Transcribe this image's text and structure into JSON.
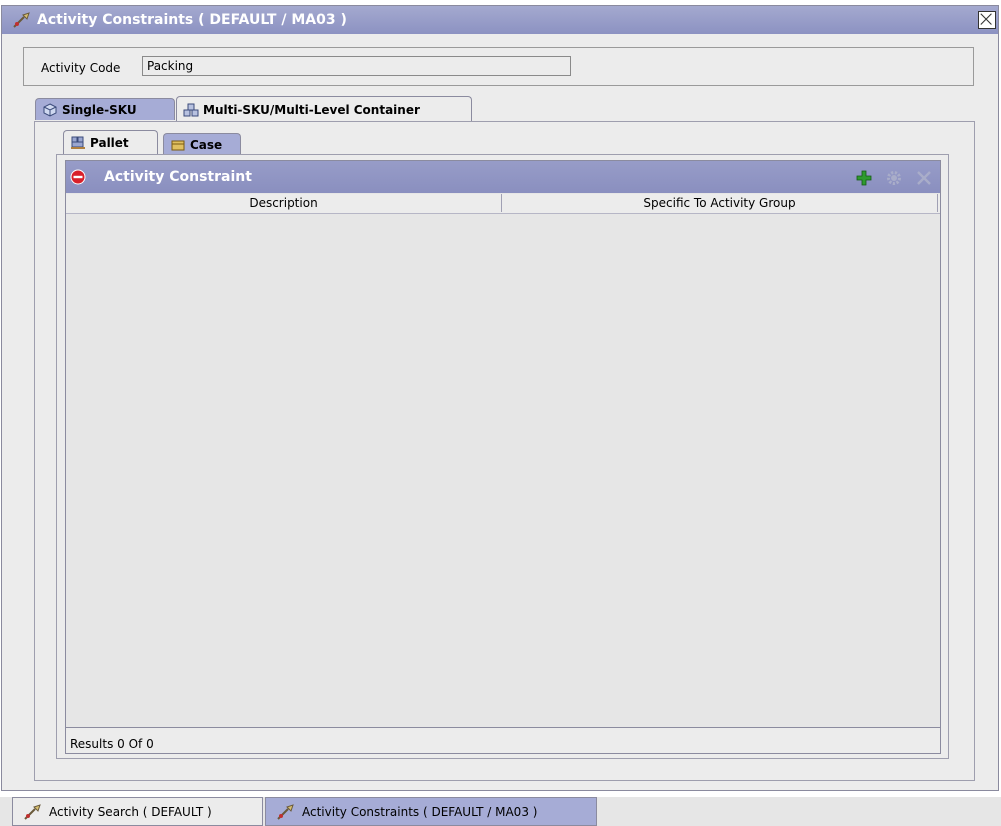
{
  "window": {
    "title": "Activity Constraints ( DEFAULT / MA03 )"
  },
  "form": {
    "activity_code_label": "Activity Code",
    "activity_code_value": "Packing"
  },
  "outer_tabs": [
    {
      "label": "Single-SKU",
      "icon": "cube-icon",
      "active": false
    },
    {
      "label": "Multi-SKU/Multi-Level Container",
      "icon": "multi-container-icon",
      "active": true
    }
  ],
  "inner_tabs": [
    {
      "label": "Pallet",
      "icon": "pallet-icon",
      "active": true
    },
    {
      "label": "Case",
      "icon": "case-icon",
      "active": false
    }
  ],
  "grid": {
    "title": "Activity Constraint",
    "columns": [
      "Description",
      "Specific To Activity Group"
    ],
    "rows": [],
    "footer": "Results 0  Of 0",
    "actions": [
      {
        "name": "add-icon",
        "enabled": true
      },
      {
        "name": "gear-icon",
        "enabled": false
      },
      {
        "name": "delete-icon",
        "enabled": false
      }
    ]
  },
  "taskbar": [
    {
      "label": "Activity Search ( DEFAULT )",
      "active": false
    },
    {
      "label": "Activity Constraints ( DEFAULT / MA03 )",
      "active": true
    }
  ],
  "colors": {
    "title_bar": "#8c92c2",
    "tab_inactive": "#a6acd6",
    "panel_bg": "#ececec",
    "add_green": "#2e9a2e",
    "collapse_red": "#d8202a"
  }
}
